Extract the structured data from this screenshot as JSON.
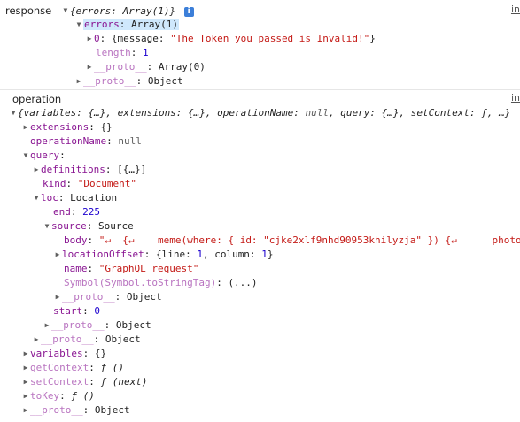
{
  "response_block": {
    "label": "response",
    "summary": "{errors: Array(1)}",
    "info_icon": "info-icon",
    "src_link": "in",
    "errors_key": "errors",
    "errors_val": "Array(1)",
    "item0_key": "0",
    "item0_pre": "{message: ",
    "item0_msg": "\"The Token you passed is Invalid!\"",
    "item0_post": "}",
    "length_key": "length",
    "length_val": "1",
    "proto_arr_key": "__proto__",
    "proto_arr_val": "Array(0)",
    "proto_obj_key": "__proto__",
    "proto_obj_val": "Object"
  },
  "operation_block": {
    "label": "operation",
    "src_link": "in",
    "summary_parts": {
      "p1": "{variables: {…}, extensions: {…}, operationName: ",
      "p_null": "null",
      "p2": ", query: {…}, setContext: ",
      "p_f": "ƒ",
      "p3": ", …}"
    },
    "extensions": {
      "key": "extensions",
      "val": "{}"
    },
    "operationName": {
      "key": "operationName",
      "val": "null"
    },
    "query": {
      "key": "query"
    },
    "definitions": {
      "key": "definitions",
      "val": "[{…}]"
    },
    "kind": {
      "key": "kind",
      "val": "\"Document\""
    },
    "loc": {
      "key": "loc",
      "val": "Location"
    },
    "end": {
      "key": "end",
      "val": "225"
    },
    "source": {
      "key": "source",
      "val": "Source"
    },
    "body": {
      "key": "body",
      "val": "\"↵  {↵    meme(where: { id: \"cjke2xlf9nhd90953khilyzja\" }) {↵      photo"
    },
    "locationOffset": {
      "key": "locationOffset",
      "pre": "{line: ",
      "line": "1",
      "mid": ", column: ",
      "column": "1",
      "post": "}"
    },
    "name": {
      "key": "name",
      "val": "\"GraphQL request\""
    },
    "symbol": {
      "key": "Symbol(Symbol.toStringTag)",
      "val": "(...)"
    },
    "source_proto": {
      "key": "__proto__",
      "val": "Object"
    },
    "start": {
      "key": "start",
      "val": "0"
    },
    "loc_proto": {
      "key": "__proto__",
      "val": "Object"
    },
    "query_proto": {
      "key": "__proto__",
      "val": "Object"
    },
    "variables": {
      "key": "variables",
      "val": "{}"
    },
    "getContext": {
      "key": "getContext",
      "f": "ƒ",
      "args": "()"
    },
    "setContext": {
      "key": "setContext",
      "f": "ƒ",
      "args": "(next)"
    },
    "toKey": {
      "key": "toKey",
      "f": "ƒ",
      "args": "()"
    },
    "op_proto": {
      "key": "__proto__",
      "val": "Object"
    }
  }
}
